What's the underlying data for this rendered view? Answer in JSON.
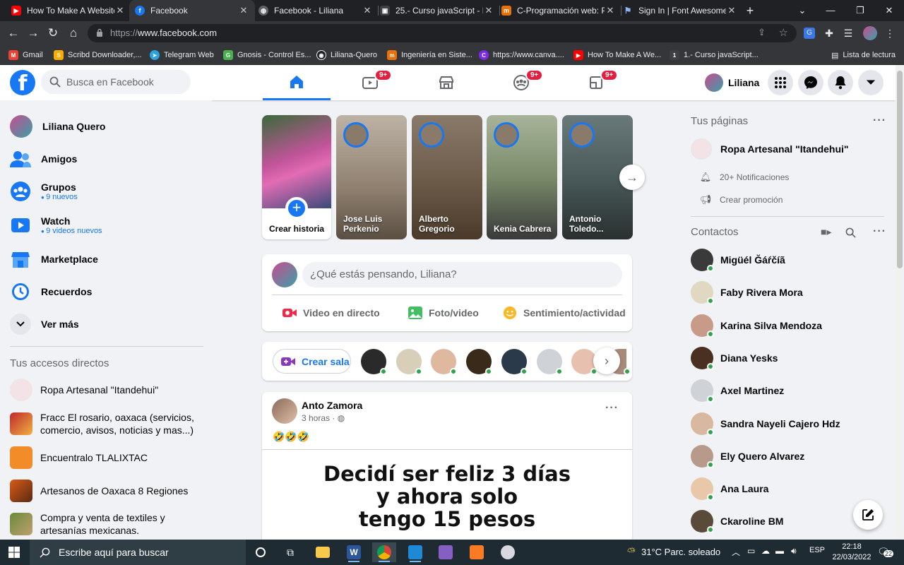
{
  "browser": {
    "tabs": [
      {
        "title": "How To Make A Website",
        "favicon": "youtube-icon",
        "color": "#ff0000"
      },
      {
        "title": "Facebook",
        "favicon": "facebook-icon",
        "color": "#1877f2",
        "active": true
      },
      {
        "title": "Facebook - Liliana",
        "favicon": "globe-icon",
        "color": "#9aa0a6"
      },
      {
        "title": "25.- Curso javaScript - F",
        "favicon": "course-icon",
        "color": "#3c4043"
      },
      {
        "title": "C-Programación web: Pr",
        "favicon": "m-icon",
        "color": "#e8710a"
      },
      {
        "title": "Sign In | Font Awesome",
        "favicon": "flag-icon",
        "color": "#8ab4f8"
      }
    ],
    "url_scheme": "https://",
    "url_host": "www.facebook.com",
    "bookmarks": [
      {
        "label": "Gmail",
        "color": "#ea4335",
        "glyph": "M"
      },
      {
        "label": "Scribd Downloader,...",
        "color": "#f9ab00",
        "glyph": "S"
      },
      {
        "label": "Telegram Web",
        "color": "#2aa3df",
        "glyph": "➤"
      },
      {
        "label": "Gnosis - Control Es...",
        "color": "#4caf50",
        "glyph": "G"
      },
      {
        "label": "Liliana-Quero",
        "color": "#202124",
        "glyph": "◉"
      },
      {
        "label": "Ingeniería en Siste...",
        "color": "#e8710a",
        "glyph": "m"
      },
      {
        "label": "https://www.canva....",
        "color": "#7d2ae8",
        "glyph": "C"
      },
      {
        "label": "How To Make A We...",
        "color": "#ff0000",
        "glyph": "▶"
      },
      {
        "label": "1.- Curso javaScript...",
        "color": "#3c4043",
        "glyph": "1"
      }
    ],
    "reading_list": "Lista de lectura"
  },
  "fb": {
    "search_placeholder": "Busca en Facebook",
    "profile_name": "Liliana",
    "badges": {
      "watch": "9+",
      "groups": "9+",
      "gaming": "9+"
    }
  },
  "left": {
    "items": [
      {
        "label": "Liliana Quero",
        "icon": "profile-avatar"
      },
      {
        "label": "Amigos",
        "icon": "friends-icon"
      },
      {
        "label": "Grupos",
        "sub": "9 nuevos",
        "icon": "groups-icon"
      },
      {
        "label": "Watch",
        "sub": "9 videos nuevos",
        "icon": "watch-icon"
      },
      {
        "label": "Marketplace",
        "icon": "marketplace-icon"
      },
      {
        "label": "Recuerdos",
        "icon": "memories-icon"
      },
      {
        "label": "Ver más",
        "icon": "chevron-down-icon"
      }
    ],
    "shortcuts_title": "Tus accesos directos",
    "shortcuts": [
      {
        "label": "Ropa Artesanal \"Itandehui\"",
        "color": "#f3e3e6"
      },
      {
        "label": "Fracc El rosario, oaxaca (servicios, comercio, avisos, noticias y mas...)",
        "color": "#c0292f"
      },
      {
        "label": "Encuentralo TLALIXTAC",
        "color": "#f28c28"
      },
      {
        "label": "Artesanos de Oaxaca 8 Regiones",
        "color": "#d85a1a"
      },
      {
        "label": "Compra y venta de textiles y artesanías mexicanas.",
        "color": "#6a8a3a"
      }
    ]
  },
  "stories": {
    "create_label": "Crear historia",
    "items": [
      {
        "name": "Jose Luis Perkenio",
        "bg": "#8e7f6f"
      },
      {
        "name": "Alberto Gregorio",
        "bg": "#6b5a48"
      },
      {
        "name": "Kenia Cabrera",
        "bg": "#7a8a6a"
      },
      {
        "name": "Antonio Toledo...",
        "bg": "#4a5a5a"
      }
    ]
  },
  "composer": {
    "placeholder": "¿Qué estás pensando, Liliana?",
    "live": "Video en directo",
    "photo": "Foto/video",
    "feeling": "Sentimiento/actividad"
  },
  "rooms": {
    "create": "Crear sala",
    "avatars": [
      "#2a2a2a",
      "#d8cfb8",
      "#e0b8a0",
      "#3a2a1a",
      "#2a3a4a",
      "#cfd3d8",
      "#e8c0b0",
      "#a88a7a"
    ]
  },
  "post": {
    "author": "Anto Zamora",
    "time": "3 horas · ",
    "emoji": "🤣🤣🤣",
    "image_text_1": "Decidí ser feliz 3 días",
    "image_text_2": "y ahora solo",
    "image_text_3": "tengo 15 pesos"
  },
  "right": {
    "pages_title": "Tus páginas",
    "page_name": "Ropa Artesanal \"Itandehui\"",
    "notifications": "20+ Notificaciones",
    "promo": "Crear promoción",
    "contacts_title": "Contactos",
    "contacts": [
      {
        "name": "Migüél Ğáŕčíã",
        "color": "#3a3a3a"
      },
      {
        "name": "Faby Rivera Mora",
        "color": "#e0d8c0"
      },
      {
        "name": "Karina Silva Mendoza",
        "color": "#c89a88"
      },
      {
        "name": "Diana Yesks",
        "color": "#4a3020"
      },
      {
        "name": "Axel Martinez",
        "color": "#cfd3d8"
      },
      {
        "name": "Sandra Nayeli Cajero Hdz",
        "color": "#d8b8a0"
      },
      {
        "name": "Ely Quero Alvarez",
        "color": "#b89a8a"
      },
      {
        "name": "Ana Laura",
        "color": "#e8c8a8"
      },
      {
        "name": "Ckaroline BM",
        "color": "#5a4a3a"
      }
    ]
  },
  "taskbar": {
    "search": "Escribe aquí para buscar",
    "weather": "31°C  Parc. soleado",
    "lang": "ESP",
    "time": "22:18",
    "date": "22/03/2022",
    "notif_count": "22"
  }
}
